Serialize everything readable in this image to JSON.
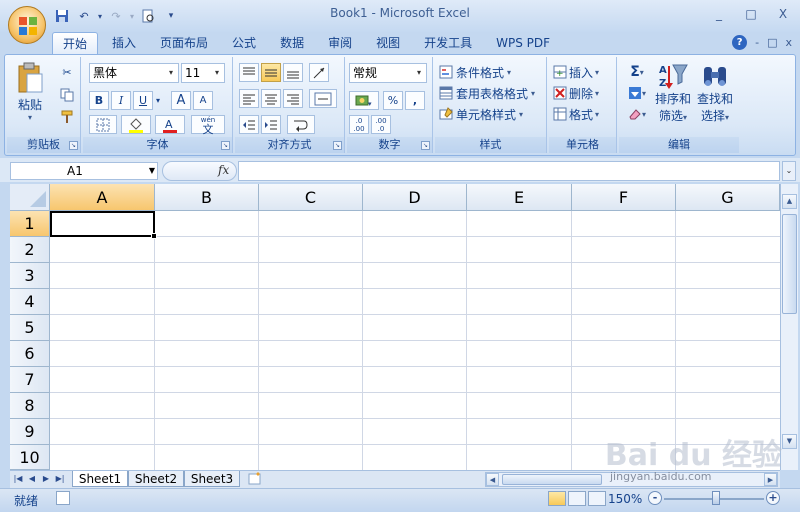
{
  "window": {
    "title": "Book1 - Microsoft Excel",
    "controls": [
      "_",
      "□",
      "X"
    ]
  },
  "quick_access": {
    "customize": "▾"
  },
  "tabs": [
    {
      "label": "开始",
      "active": true
    },
    {
      "label": "插入"
    },
    {
      "label": "页面布局"
    },
    {
      "label": "公式"
    },
    {
      "label": "数据"
    },
    {
      "label": "审阅"
    },
    {
      "label": "视图"
    },
    {
      "label": "开发工具"
    },
    {
      "label": "WPS PDF"
    }
  ],
  "ribbon_right": {
    "help": "?",
    "min": "-",
    "restore": "□",
    "close": "x"
  },
  "groups": {
    "clipboard": {
      "label": "剪贴板",
      "paste": "粘贴"
    },
    "font": {
      "label": "字体",
      "font_name": "黑体",
      "font_size": "11",
      "bold": "B",
      "italic": "I",
      "underline": "U",
      "grow": "A",
      "shrink": "A",
      "phonetic": "wén",
      "phonetic_char": "文"
    },
    "alignment": {
      "label": "对齐方式"
    },
    "number": {
      "label": "数字",
      "format": "常规",
      "percent": "%",
      "comma": ",",
      "inc_decimal": ".00",
      "dec_decimal": ".0"
    },
    "styles": {
      "label": "样式",
      "conditional": "条件格式",
      "table": "套用表格格式",
      "cell_styles": "单元格样式"
    },
    "cells": {
      "label": "单元格",
      "insert": "插入",
      "delete": "删除",
      "format": "格式"
    },
    "editing": {
      "label": "编辑",
      "sum": "Σ",
      "sort": "排序和",
      "sort2": "筛选",
      "find": "查找和",
      "find2": "选择"
    }
  },
  "formula_bar": {
    "name_box": "A1",
    "fx": "fx",
    "value": ""
  },
  "columns": [
    "A",
    "B",
    "C",
    "D",
    "E",
    "F",
    "G"
  ],
  "rows": [
    "1",
    "2",
    "3",
    "4",
    "5",
    "6",
    "7",
    "8",
    "9",
    "10"
  ],
  "selected_cell": "A1",
  "sheets": [
    {
      "name": "Sheet1",
      "active": true
    },
    {
      "name": "Sheet2"
    },
    {
      "name": "Sheet3"
    }
  ],
  "status": {
    "ready": "就绪",
    "zoom": "150%",
    "minus": "-",
    "plus": "+"
  },
  "watermark": {
    "brand": "Bai du 经验",
    "url": "jingyan.baidu.com"
  },
  "colors": {
    "accent": "#15428b",
    "selected_header": "#f7c66e",
    "ribbon_border": "#8db2e3"
  }
}
